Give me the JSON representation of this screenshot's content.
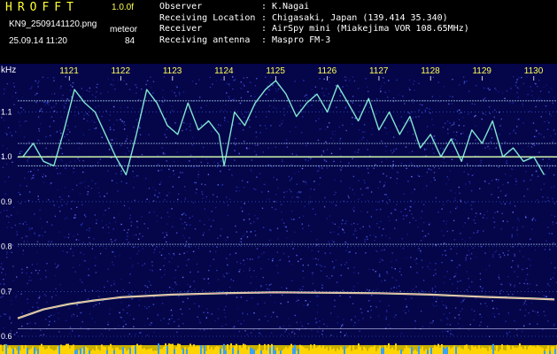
{
  "header": {
    "app_title": "HROFFT",
    "app_version": "1.0.0f",
    "file_name": "KN9_2509141120.png",
    "mode_label": "meteor",
    "date_time": "25.09.14 11:20",
    "mode_value": "84",
    "info": [
      {
        "key": "Observer",
        "value": "K.Nagai"
      },
      {
        "key": "Receiving Location",
        "value": "Chigasaki, Japan (139.414 35.340)"
      },
      {
        "key": "Receiver",
        "value": "AirSpy mini (Miakejima VOR 108.65MHz)"
      },
      {
        "key": "Receiving antenna",
        "value": "Maspro FM-3"
      }
    ]
  },
  "chart_data": {
    "type": "spectrogram",
    "x_axis": {
      "ticks": [
        "1121",
        "1122",
        "1123",
        "1124",
        "1125",
        "1126",
        "1127",
        "1128",
        "1129",
        "1130"
      ]
    },
    "y_axis": {
      "unit_label": "kHz",
      "ticks": [
        1.1,
        1.0,
        0.9,
        0.8,
        0.7,
        0.6
      ],
      "range": [
        0.6,
        1.18
      ]
    },
    "carrier_lines_khz": [
      1.125,
      1.0,
      1.03,
      0.98,
      0.805
    ],
    "drift_trace": {
      "description": "meteor / aircraft doppler trace",
      "points": [
        [
          1120.1,
          1.0
        ],
        [
          1120.3,
          1.03
        ],
        [
          1120.5,
          0.99
        ],
        [
          1120.7,
          0.98
        ],
        [
          1120.9,
          1.06
        ],
        [
          1121.1,
          1.15
        ],
        [
          1121.3,
          1.12
        ],
        [
          1121.5,
          1.1
        ],
        [
          1121.7,
          1.05
        ],
        [
          1121.9,
          1.0
        ],
        [
          1122.1,
          0.96
        ],
        [
          1122.3,
          1.05
        ],
        [
          1122.5,
          1.15
        ],
        [
          1122.7,
          1.12
        ],
        [
          1122.9,
          1.07
        ],
        [
          1123.1,
          1.05
        ],
        [
          1123.3,
          1.12
        ],
        [
          1123.5,
          1.06
        ],
        [
          1123.7,
          1.08
        ],
        [
          1123.9,
          1.05
        ],
        [
          1124.0,
          0.98
        ],
        [
          1124.2,
          1.1
        ],
        [
          1124.4,
          1.07
        ],
        [
          1124.6,
          1.12
        ],
        [
          1124.8,
          1.15
        ],
        [
          1125.0,
          1.17
        ],
        [
          1125.2,
          1.14
        ],
        [
          1125.4,
          1.09
        ],
        [
          1125.6,
          1.12
        ],
        [
          1125.8,
          1.14
        ],
        [
          1126.0,
          1.1
        ],
        [
          1126.2,
          1.16
        ],
        [
          1126.4,
          1.12
        ],
        [
          1126.6,
          1.08
        ],
        [
          1126.8,
          1.13
        ],
        [
          1127.0,
          1.06
        ],
        [
          1127.2,
          1.1
        ],
        [
          1127.4,
          1.05
        ],
        [
          1127.6,
          1.09
        ],
        [
          1127.8,
          1.02
        ],
        [
          1128.0,
          1.05
        ],
        [
          1128.2,
          1.0
        ],
        [
          1128.4,
          1.04
        ],
        [
          1128.6,
          0.99
        ],
        [
          1128.8,
          1.06
        ],
        [
          1129.0,
          1.03
        ],
        [
          1129.2,
          1.08
        ],
        [
          1129.4,
          1.0
        ],
        [
          1129.6,
          1.02
        ],
        [
          1129.8,
          0.99
        ],
        [
          1130.0,
          1.0
        ],
        [
          1130.2,
          0.96
        ]
      ]
    },
    "curve_trace": {
      "description": "rising arc near 0.7 kHz",
      "points": [
        [
          1120.0,
          0.64
        ],
        [
          1120.5,
          0.66
        ],
        [
          1121.0,
          0.672
        ],
        [
          1121.5,
          0.68
        ],
        [
          1122.0,
          0.687
        ],
        [
          1122.5,
          0.69
        ],
        [
          1123.0,
          0.693
        ],
        [
          1124.0,
          0.696
        ],
        [
          1125.0,
          0.698
        ],
        [
          1126.0,
          0.697
        ],
        [
          1127.0,
          0.696
        ],
        [
          1128.0,
          0.693
        ],
        [
          1129.0,
          0.688
        ],
        [
          1130.0,
          0.684
        ],
        [
          1130.4,
          0.682
        ]
      ]
    },
    "colors": {
      "background_noise": "#0a0a60",
      "noise_speck": "#3b4bd0",
      "grid_line": "#4a8cff",
      "carrier": "#bfe6ff",
      "trace": "#8fffe0",
      "tick_label": "#ffff55",
      "bottom_strip": "#ffd400"
    }
  }
}
